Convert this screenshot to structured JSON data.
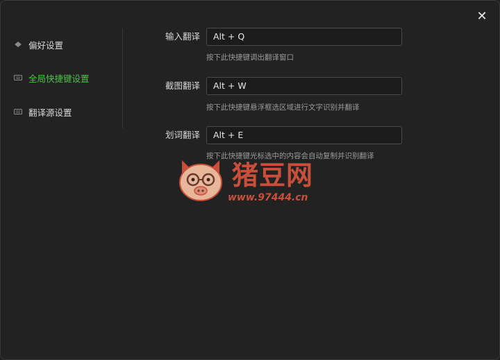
{
  "window": {
    "close_label": "✕"
  },
  "sidebar": {
    "items": [
      {
        "label": "偏好设置",
        "icon": "diamond-icon",
        "active": false
      },
      {
        "label": "全局快捷键设置",
        "icon": "keyboard-icon",
        "active": true
      },
      {
        "label": "翻译源设置",
        "icon": "keyboard-icon",
        "active": false
      }
    ]
  },
  "shortcuts": [
    {
      "label": "输入翻译",
      "value": "Alt + Q",
      "hint": "按下此快捷键调出翻译窗口"
    },
    {
      "label": "截图翻译",
      "value": "Alt + W",
      "hint": "按下此快捷键悬浮框选区域进行文字识别并翻译"
    },
    {
      "label": "划词翻译",
      "value": "Alt + E",
      "hint": "按下此快捷键光标选中的内容会自动复制并识别翻译"
    }
  ],
  "watermark": {
    "title": "猪豆网",
    "url": "www.97444.cn"
  },
  "colors": {
    "accent": "#4fc04a",
    "background": "#222223",
    "input_border": "#4a4a4a",
    "watermark": "#c8503a"
  }
}
